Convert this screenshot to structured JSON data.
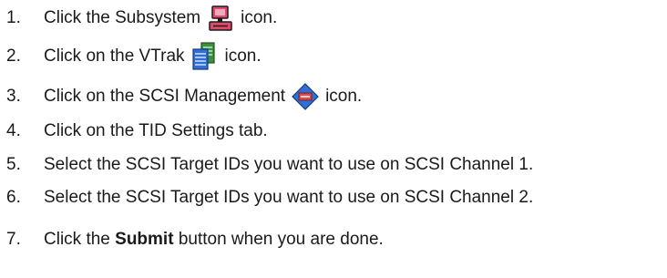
{
  "steps": [
    {
      "number": "1.",
      "before": "Click the Subsystem",
      "after": "icon.",
      "icon": "subsystem-icon"
    },
    {
      "number": "2.",
      "before": "Click on the VTrak",
      "after": "icon.",
      "icon": "vtrak-icon"
    },
    {
      "number": "3.",
      "before": "Click on the SCSI Management",
      "after": "icon.",
      "icon": "scsi-management-icon"
    },
    {
      "number": "4.",
      "text": "Click on the TID Settings tab."
    },
    {
      "number": "5.",
      "text": "Select the SCSI Target IDs you want to use on SCSI Channel 1."
    },
    {
      "number": "6.",
      "text": "Select the SCSI Target IDs you want to use on SCSI Channel 2."
    },
    {
      "number": "7.",
      "before": "Click the",
      "bold": "Submit",
      "after": "button when you are done."
    }
  ],
  "colors": {
    "text": "#1a1a1a",
    "subsystem_icon": "#e04a6a",
    "vtrak_icon": "#3c8f3c",
    "scsi_icon": "#2f6fd6"
  }
}
